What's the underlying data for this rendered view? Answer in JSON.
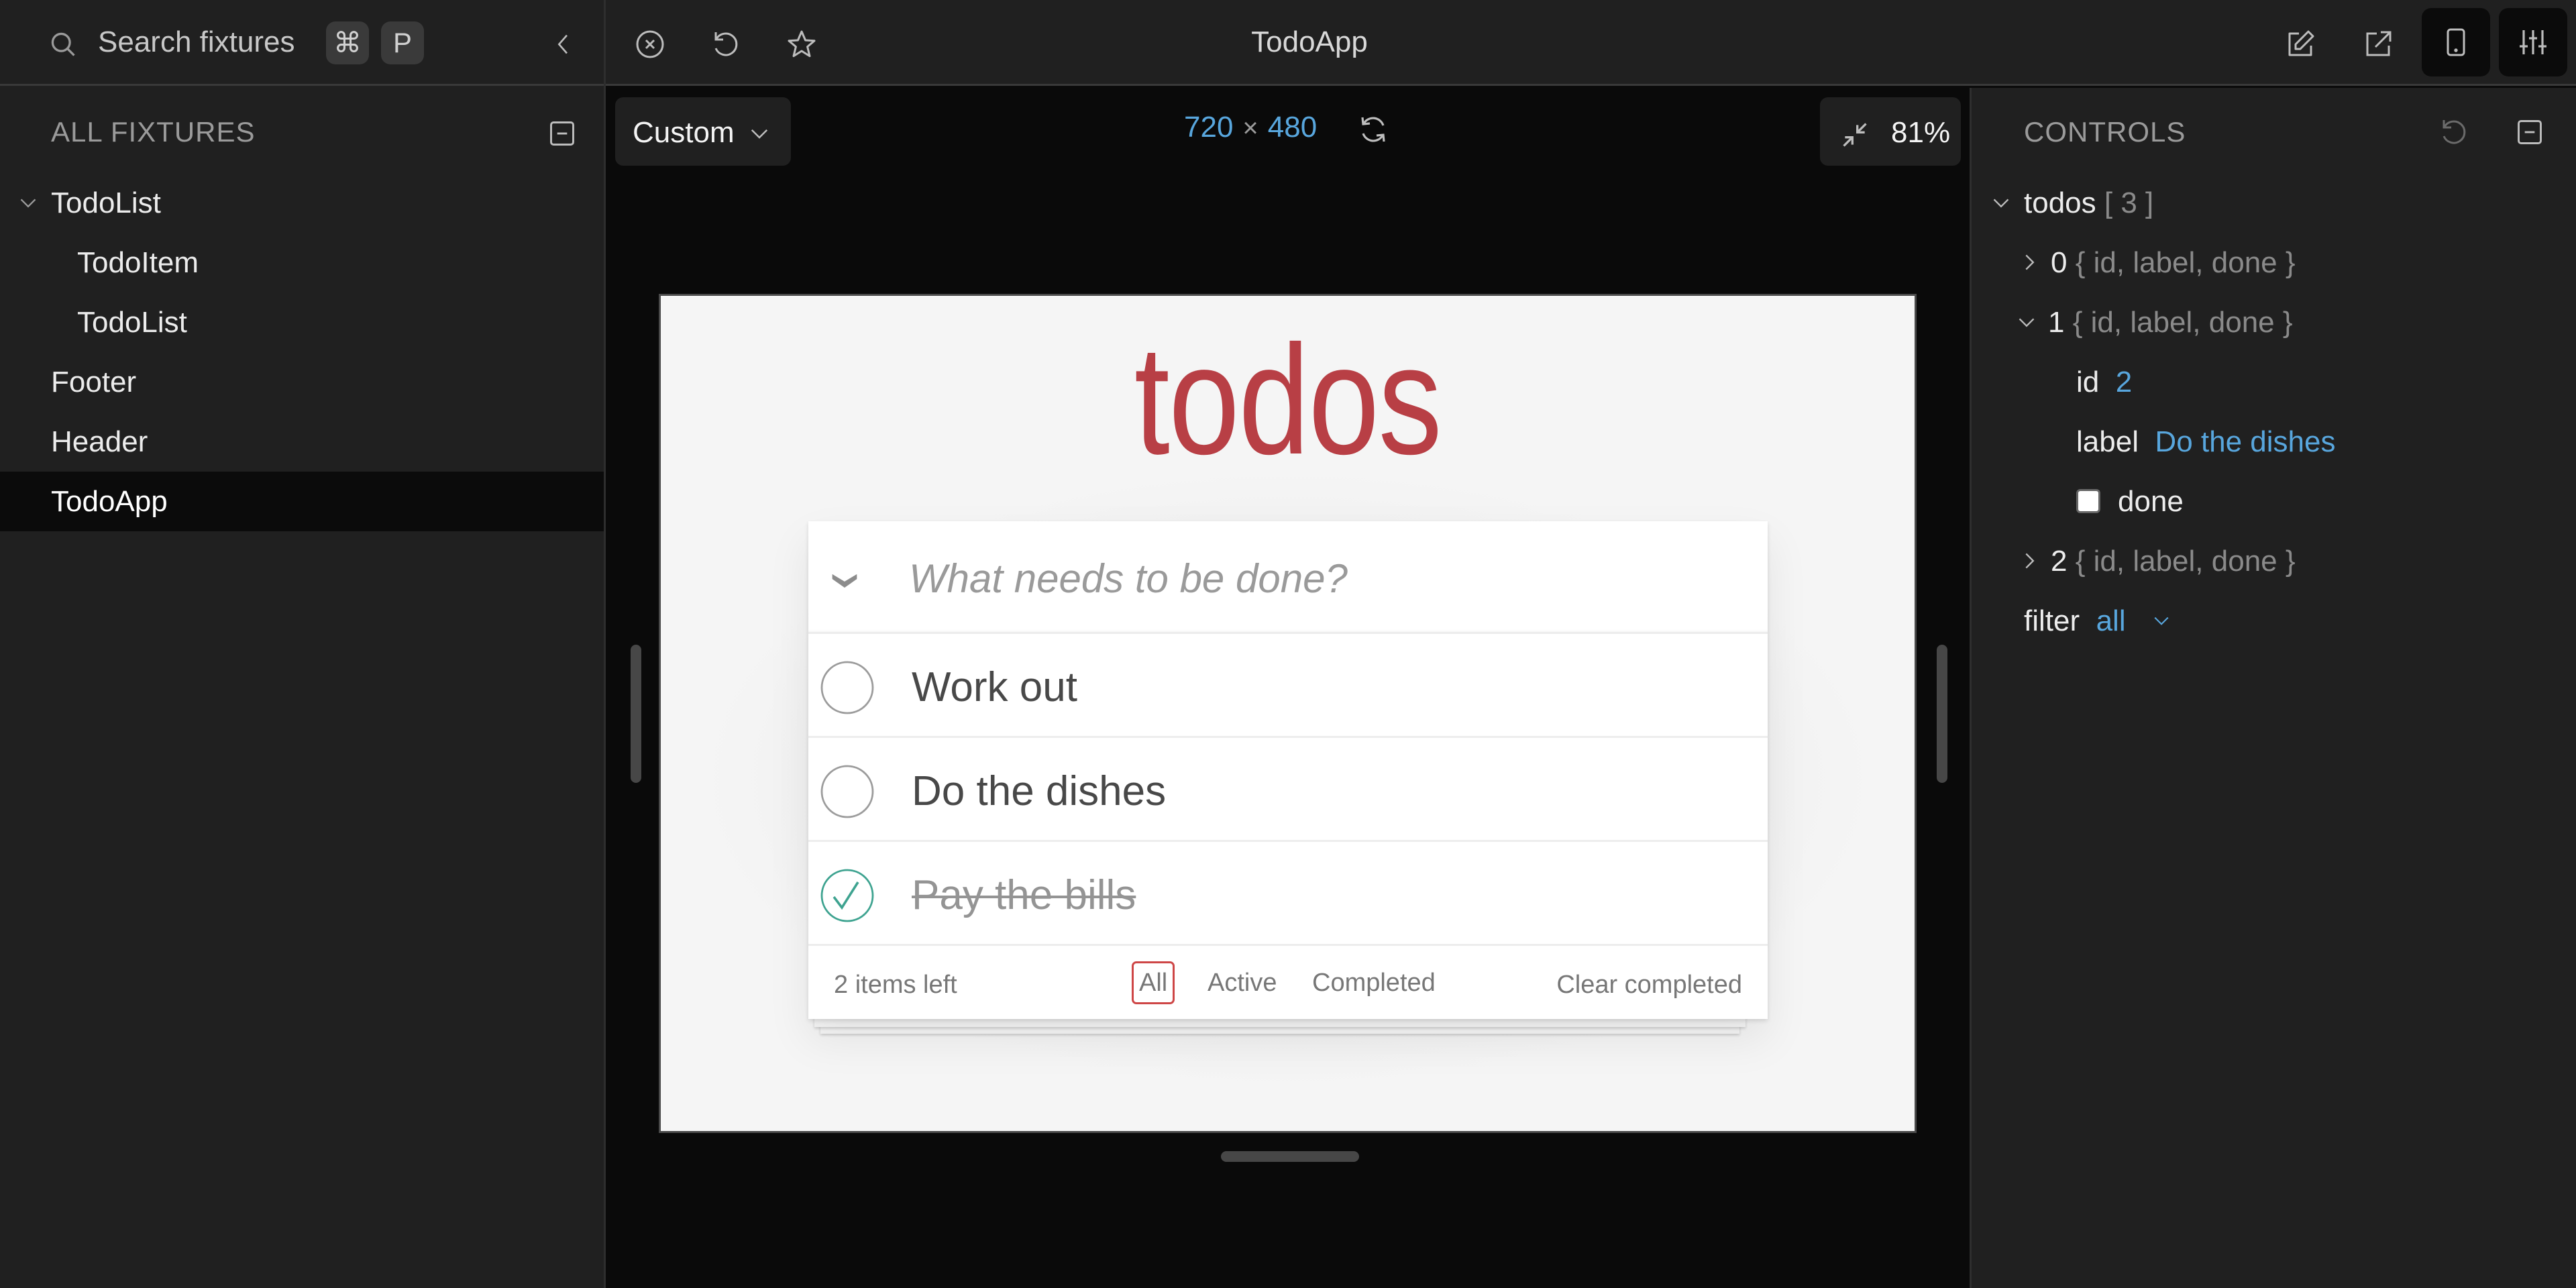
{
  "sidebar": {
    "search": {
      "placeholder": "Search fixtures",
      "shortcut_keys": [
        "⌘",
        "P"
      ]
    },
    "section_title": "ALL FIXTURES",
    "tree": [
      {
        "label": "TodoList",
        "type": "folder",
        "expanded": true,
        "depth": 0
      },
      {
        "label": "TodoItem",
        "type": "fixture",
        "depth": 1
      },
      {
        "label": "TodoList",
        "type": "fixture",
        "depth": 1
      },
      {
        "label": "Footer",
        "type": "fixture",
        "depth": 0
      },
      {
        "label": "Header",
        "type": "fixture",
        "depth": 0
      },
      {
        "label": "TodoApp",
        "type": "fixture",
        "depth": 0,
        "selected": true
      }
    ],
    "icons": {
      "search": "search-icon",
      "collapse_sidebar": "chevron-left-icon",
      "collapse_all": "collapse-all-icon"
    }
  },
  "topbar": {
    "title": "TodoApp",
    "left_icons": [
      "close-fixture-icon",
      "reload-icon",
      "star-icon"
    ],
    "right_icons": [
      "edit-icon",
      "open-external-icon",
      "device-responsive-icon",
      "controls-panel-icon"
    ]
  },
  "stage": {
    "viewport": {
      "selected": "Custom"
    },
    "dimensions": {
      "width": "720",
      "height": "480",
      "separator": "×"
    },
    "zoom": "81%",
    "icons": {
      "rotate": "rotate-icon",
      "fit": "fit-to-screen-icon",
      "dropdown": "chevron-down-icon"
    }
  },
  "todo_app": {
    "title": "todos",
    "input_placeholder": "What needs to be done?",
    "input_value": "",
    "items": [
      {
        "label": "Work out",
        "done": false
      },
      {
        "label": "Do the dishes",
        "done": false
      },
      {
        "label": "Pay the bills",
        "done": true
      }
    ],
    "footer": {
      "items_left": "2 items left",
      "filters": [
        "All",
        "Active",
        "Completed"
      ],
      "active_filter": "All",
      "clear_completed": "Clear completed"
    },
    "colors": {
      "title": "#b83f45",
      "active_filter_border": "#ce4646",
      "check_done": "#3ea390"
    }
  },
  "controls": {
    "title": "CONTROLS",
    "todos": {
      "key": "todos",
      "summary": "[ 3 ]"
    },
    "items": [
      {
        "index": "0",
        "summary": "{ id, label, done }",
        "expanded": false
      },
      {
        "index": "1",
        "summary": "{ id, label, done }",
        "expanded": true,
        "fields": {
          "id_key": "id",
          "id_value": "2",
          "label_key": "label",
          "label_value": "Do the dishes",
          "done_key": "done",
          "done_value": false
        }
      },
      {
        "index": "2",
        "summary": "{ id, label, done }",
        "expanded": false
      }
    ],
    "filter": {
      "key": "filter",
      "value": "all"
    },
    "icons": {
      "reset": "reset-icon",
      "collapse": "collapse-all-icon"
    },
    "colors": {
      "value": "#58a6dd"
    }
  }
}
